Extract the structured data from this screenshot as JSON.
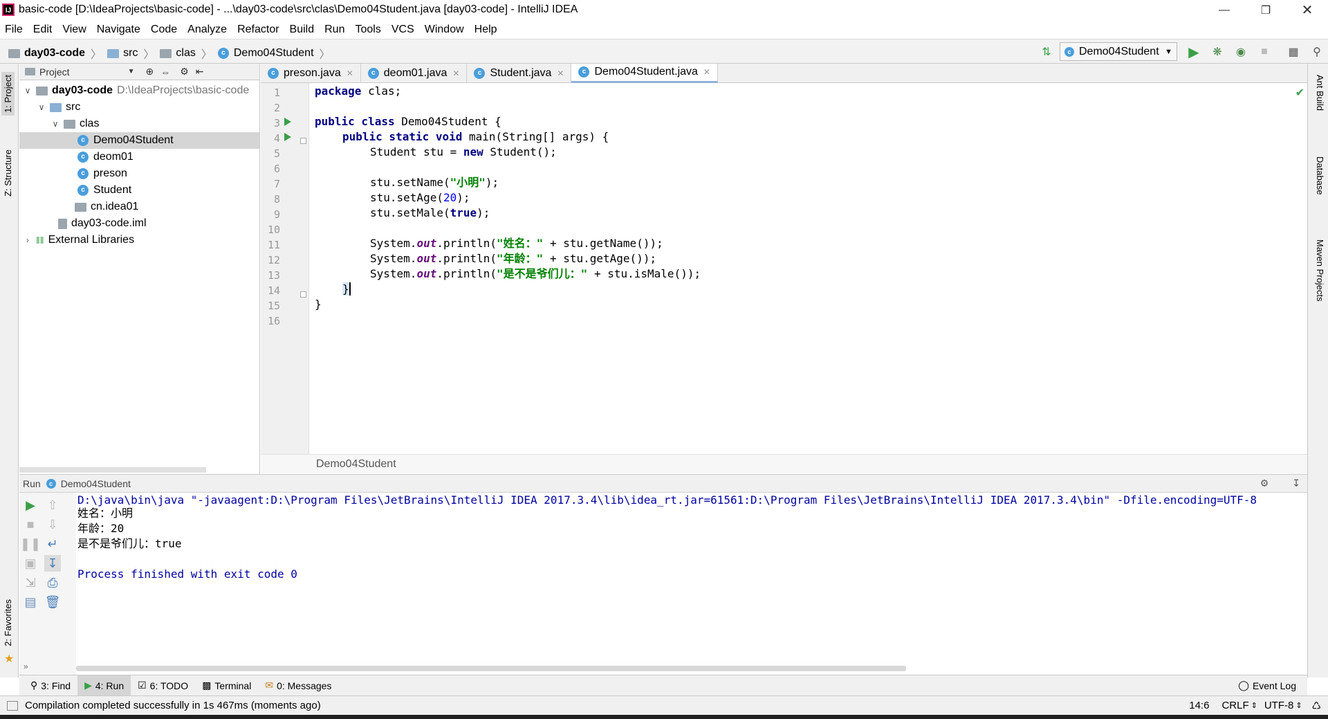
{
  "window": {
    "title": "basic-code [D:\\IdeaProjects\\basic-code] - ...\\day03-code\\src\\clas\\Demo04Student.java [day03-code] - IntelliJ IDEA",
    "app_icon": "IJ"
  },
  "menu": [
    "File",
    "Edit",
    "View",
    "Navigate",
    "Code",
    "Analyze",
    "Refactor",
    "Build",
    "Run",
    "Tools",
    "VCS",
    "Window",
    "Help"
  ],
  "breadcrumb": [
    "day03-code",
    "src",
    "clas",
    "Demo04Student"
  ],
  "run_config": "Demo04Student",
  "project_panel": {
    "title": "Project",
    "tree": [
      {
        "label": "day03-code",
        "path": "D:\\IdeaProjects\\basic-code"
      },
      {
        "label": "src"
      },
      {
        "label": "clas"
      },
      {
        "label": "Demo04Student"
      },
      {
        "label": "deom01"
      },
      {
        "label": "preson"
      },
      {
        "label": "Student"
      },
      {
        "label": "cn.idea01"
      },
      {
        "label": "day03-code.iml"
      },
      {
        "label": "External Libraries"
      }
    ]
  },
  "left_tabs": [
    "1: Project",
    "Z: Structure",
    "2: Favorites"
  ],
  "right_tabs": [
    "Ant Build",
    "Database",
    "Maven Projects"
  ],
  "editor_tabs": [
    "preson.java",
    "deom01.java",
    "Student.java",
    "Demo04Student.java"
  ],
  "editor": {
    "line_numbers": [
      "1",
      "2",
      "3",
      "4",
      "5",
      "6",
      "7",
      "8",
      "9",
      "10",
      "11",
      "12",
      "13",
      "14",
      "15",
      "16"
    ],
    "lines": {
      "l1_kw": "package",
      "l1_rest": " clas;",
      "l3_kw": "public class",
      "l3_rest": " Demo04Student {",
      "l4_kw": "public static void",
      "l4_rest": " main(String[] args) {",
      "l5_a": "Student stu = ",
      "l5_kw": "new",
      "l5_b": " Student();",
      "l7_a": "stu.setName(",
      "l7_str": "\"小明\"",
      "l7_b": ");",
      "l8_a": "stu.setAge(",
      "l8_num": "20",
      "l8_b": ");",
      "l9_a": "stu.setMale(",
      "l9_kw": "true",
      "l9_b": ");",
      "l11_a": "System.",
      "l11_f": "out",
      "l11_b": ".println(",
      "l11_str": "\"姓名：\"",
      "l11_c": " + stu.getName());",
      "l12_a": "System.",
      "l12_f": "out",
      "l12_b": ".println(",
      "l12_str": "\"年龄：\"",
      "l12_c": " + stu.getAge());",
      "l13_a": "System.",
      "l13_f": "out",
      "l13_b": ".println(",
      "l13_str": "\"是不是爷们儿：\"",
      "l13_c": " + stu.isMale());",
      "l14": "}",
      "l15": "}"
    },
    "footer_breadcrumb": "Demo04Student"
  },
  "run_panel": {
    "label": "Run",
    "config": "Demo04Student",
    "output": [
      "D:\\java\\bin\\java \"-javaagent:D:\\Program Files\\JetBrains\\IntelliJ IDEA 2017.3.4\\lib\\idea_rt.jar=61561:D:\\Program Files\\JetBrains\\IntelliJ IDEA 2017.3.4\\bin\" -Dfile.encoding=UTF-8",
      "姓名：小明",
      "年龄：20",
      "是不是爷们儿：true",
      "",
      "Process finished with exit code 0"
    ]
  },
  "bottom_tabs": [
    "3: Find",
    "4: Run",
    "6: TODO",
    "Terminal",
    "0: Messages"
  ],
  "event_log": "Event Log",
  "status": {
    "message": "Compilation completed successfully in 1s 467ms (moments ago)",
    "position": "14:6",
    "line_sep": "CRLF",
    "encoding": "UTF-8"
  },
  "colors": {
    "keyword": "#000080",
    "string": "#008000",
    "number": "#0000ff",
    "run_green": "#39a047",
    "console_blue": "#0000a0"
  }
}
